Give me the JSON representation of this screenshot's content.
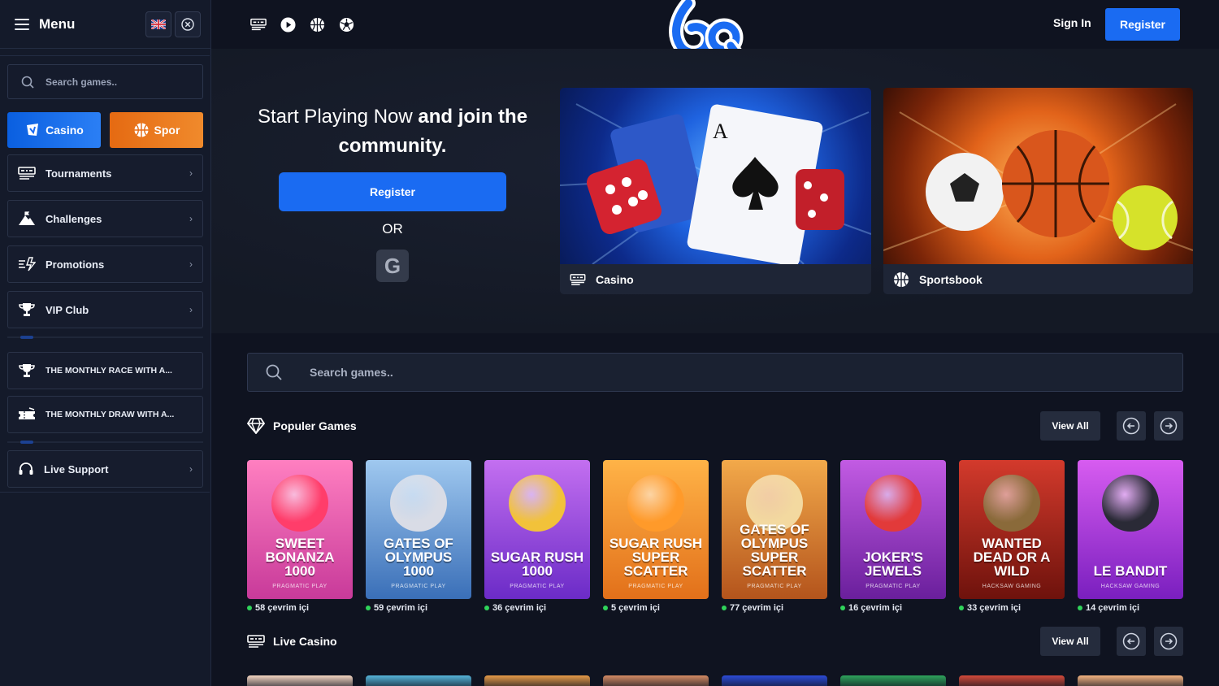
{
  "sidebar": {
    "menu_title": "Menu",
    "search_placeholder": "Search games..",
    "toggle_casino": "Casino",
    "toggle_spor": "Spor",
    "items": [
      {
        "label": "Tournaments",
        "icon": "tournaments-icon"
      },
      {
        "label": "Challenges",
        "icon": "mountain-flag-icon"
      },
      {
        "label": "Promotions",
        "icon": "promotions-icon"
      },
      {
        "label": "VIP Club",
        "icon": "trophy-icon"
      }
    ],
    "events": [
      {
        "label": "THE MONTHLY RACE WITH A...",
        "icon": "trophy-icon"
      },
      {
        "label": "THE MONTHLY DRAW WITH A...",
        "icon": "ticket-icon"
      }
    ],
    "support": "Live Support",
    "chevron": "›"
  },
  "header": {
    "logo": "6q",
    "sign_in": "Sign In",
    "register": "Register"
  },
  "hero": {
    "line1_light": "Start Playing Now",
    "line1_bold": "and join the",
    "line2_bold": "community.",
    "register": "Register",
    "or": "OR",
    "google": "G",
    "cards": [
      {
        "label": "Casino",
        "icon": "casino-icon"
      },
      {
        "label": "Sportsbook",
        "icon": "basketball-icon"
      }
    ]
  },
  "games_search_placeholder": "Search games..",
  "popular": {
    "title": "Populer Games",
    "view_all": "View All",
    "games": [
      {
        "name": "SWEET BONANZA 1000",
        "provider": "PRAGMATIC PLAY",
        "online": "58 çevrim içi",
        "c1": "#ff7fc0",
        "c2": "#c83a9a",
        "blob": "#ff3d6a"
      },
      {
        "name": "GATES OF OLYMPUS 1000",
        "provider": "PRAGMATIC PLAY",
        "online": "59 çevrim içi",
        "c1": "#9fc8ef",
        "c2": "#3a6fb8",
        "blob": "#d9dce6"
      },
      {
        "name": "SUGAR RUSH 1000",
        "provider": "PRAGMATIC PLAY",
        "online": "36 çevrim içi",
        "c1": "#c36ff0",
        "c2": "#6b2bc7",
        "blob": "#f2c23a"
      },
      {
        "name": "SUGAR RUSH SUPER SCATTER",
        "provider": "PRAGMATIC PLAY",
        "online": "5 çevrim içi",
        "c1": "#ffb347",
        "c2": "#e2701a",
        "blob": "#ff9a2a"
      },
      {
        "name": "GATES OF OLYMPUS SUPER SCATTER",
        "provider": "PRAGMATIC PLAY",
        "online": "77 çevrim içi",
        "c1": "#f2a94a",
        "c2": "#b4541c",
        "blob": "#f3d9a0"
      },
      {
        "name": "JOKER'S JEWELS",
        "provider": "PRAGMATIC PLAY",
        "online": "16 çevrim içi",
        "c1": "#c25be3",
        "c2": "#6a1f9c",
        "blob": "#e23a3a"
      },
      {
        "name": "WANTED DEAD OR A WILD",
        "provider": "HACKSAW GAMING",
        "online": "33 çevrim içi",
        "c1": "#d33a2c",
        "c2": "#6e120c",
        "blob": "#8a6a3a"
      },
      {
        "name": "LE BANDIT",
        "provider": "HACKSAW GAMING",
        "online": "14 çevrim içi",
        "c1": "#d75cf0",
        "c2": "#7a1fbf",
        "blob": "#2a2a36"
      }
    ]
  },
  "live": {
    "title": "Live Casino",
    "view_all": "View All",
    "colors": [
      "#f2d4c0",
      "#55b3d8",
      "#e59a48",
      "#d28a63",
      "#2c4bd6",
      "#2ea25b",
      "#d24a3a",
      "#f2b280"
    ]
  },
  "colors": {
    "accent": "#1a6bf2",
    "spor": "#e56a12",
    "online": "#2fd35a"
  }
}
